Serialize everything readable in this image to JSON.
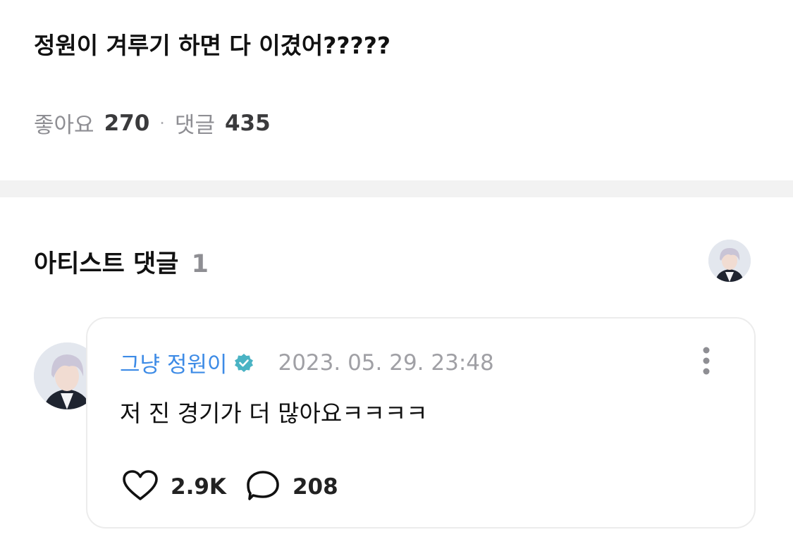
{
  "post": {
    "title": "정원이 겨루기 하면 다 이겼어?????",
    "likes_label": "좋아요",
    "likes_count": "270",
    "separator": "·",
    "comments_label": "댓글",
    "comments_count": "435"
  },
  "artist_comments": {
    "title": "아티스트 댓글",
    "count": "1"
  },
  "comment": {
    "author": "그냥 정원이",
    "timestamp": "2023. 05. 29. 23:48",
    "text": "저 진 경기가 더 많아요ㅋㅋㅋㅋ",
    "likes": "2.9K",
    "replies": "208"
  },
  "colors": {
    "author_blue": "#3d8be6",
    "verified_teal": "#4ab3c4",
    "muted_gray": "#8e8e93",
    "band_gray": "#f2f2f2"
  },
  "icons": {
    "verified": "verified-badge-icon",
    "more": "more-vertical-icon",
    "like": "heart-icon",
    "reply": "speech-bubble-icon"
  }
}
